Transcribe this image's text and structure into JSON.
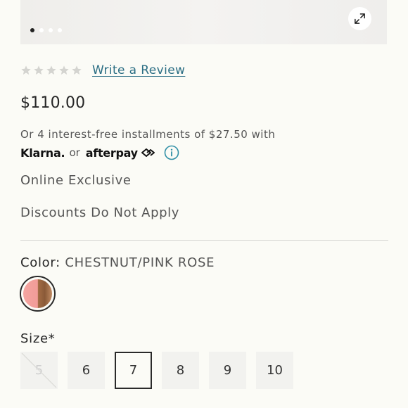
{
  "gallery": {
    "dots": [
      {
        "active": true
      },
      {
        "active": false
      },
      {
        "active": false
      },
      {
        "active": false
      }
    ],
    "expand_icon": "expand-arrows-icon"
  },
  "rating": {
    "stars_filled": 0,
    "stars_total": 5,
    "review_link": "Write a Review"
  },
  "price": "$110.00",
  "installments": {
    "text": "Or 4 interest-free installments of $27.50 with",
    "klarna": "Klarna.",
    "or": "or",
    "afterpay": "afterpay"
  },
  "badges": {
    "exclusive": "Online Exclusive",
    "discounts": "Discounts Do Not Apply"
  },
  "color": {
    "label": "Color:",
    "value": "CHESTNUT/PINK ROSE"
  },
  "size": {
    "label": "Size*",
    "options": [
      {
        "label": "5",
        "available": false,
        "selected": false
      },
      {
        "label": "6",
        "available": true,
        "selected": false
      },
      {
        "label": "7",
        "available": true,
        "selected": true
      },
      {
        "label": "8",
        "available": true,
        "selected": false
      },
      {
        "label": "9",
        "available": true,
        "selected": false
      },
      {
        "label": "10",
        "available": true,
        "selected": false
      }
    ]
  },
  "colors": {
    "link": "#2b6e84",
    "info_icon": "#2f8fa6",
    "star_empty": "#d4d4d0"
  }
}
